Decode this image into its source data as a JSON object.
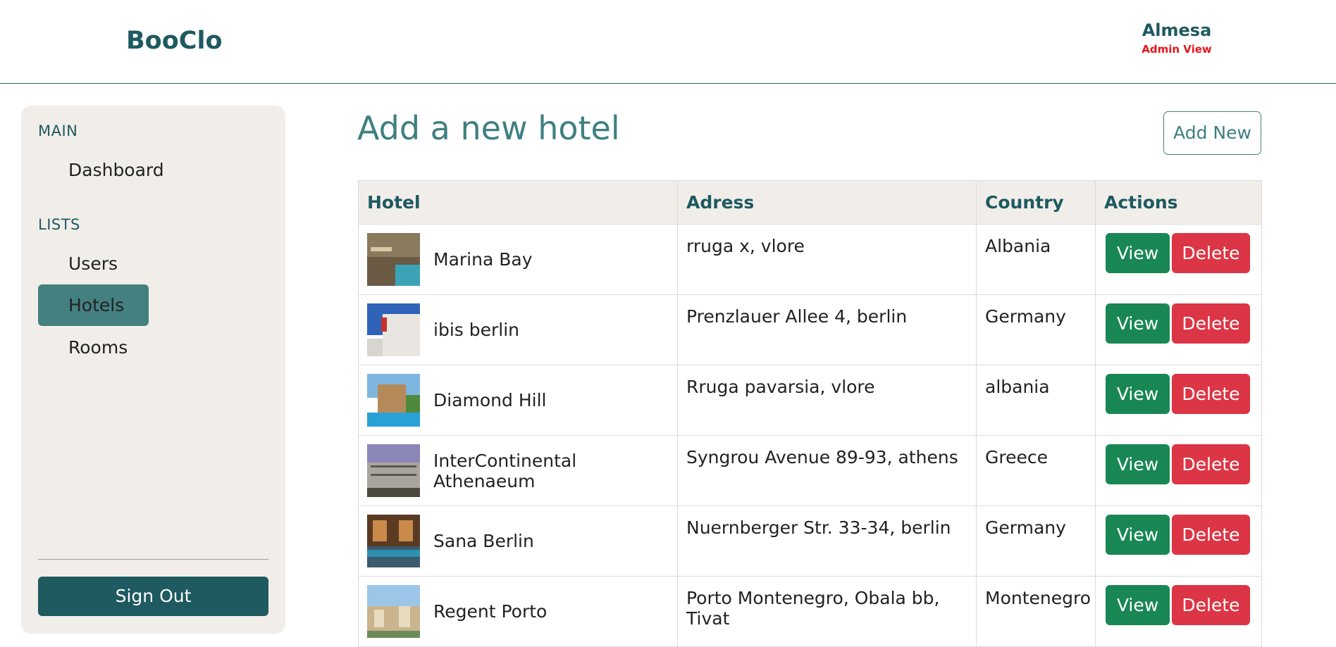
{
  "header": {
    "brand": "BooClo",
    "user_name": "Almesa",
    "user_role": "Admin View"
  },
  "sidebar": {
    "main_label": "MAIN",
    "lists_label": "LISTS",
    "items": [
      {
        "label": "Dashboard",
        "active": false
      },
      {
        "label": "Users",
        "active": false
      },
      {
        "label": "Hotels",
        "active": true
      },
      {
        "label": "Rooms",
        "active": false
      }
    ],
    "signout_label": "Sign Out"
  },
  "main": {
    "title": "Add a new hotel",
    "add_new_label": "Add New",
    "columns": [
      "Hotel",
      "Adress",
      "Country",
      "Actions"
    ],
    "view_label": "View",
    "delete_label": "Delete",
    "rows": [
      {
        "hotel": "Marina Bay",
        "address": "rruga x, vlore",
        "country": "Albania"
      },
      {
        "hotel": "ibis berlin",
        "address": "Prenzlauer Allee 4, berlin",
        "country": "Germany"
      },
      {
        "hotel": "Diamond Hill",
        "address": "Rruga pavarsia, vlore",
        "country": "albania"
      },
      {
        "hotel": "InterContinental Athenaeum",
        "address": "Syngrou Avenue 89-93, athens",
        "country": "Greece"
      },
      {
        "hotel": "Sana Berlin",
        "address": "Nuernberger Str. 33-34, berlin",
        "country": "Germany"
      },
      {
        "hotel": "Regent Porto",
        "address": "Porto Montenegro, Obala bb, Tivat",
        "country": "Montenegro"
      }
    ]
  },
  "colors": {
    "brand": "#1e5a60",
    "accent": "#3f7f80",
    "active_nav": "#448080",
    "view_button": "#198754",
    "delete_button": "#dc3545",
    "admin_role": "#e8151b"
  }
}
